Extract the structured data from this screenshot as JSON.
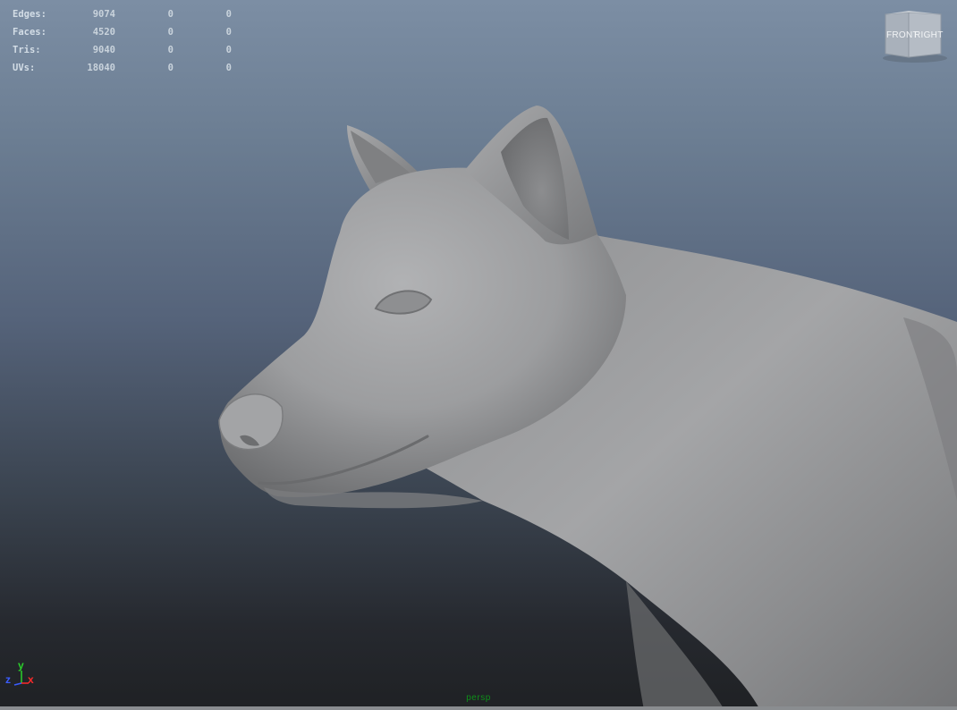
{
  "hud": {
    "rows": [
      {
        "label": "Edges:",
        "v1": "9074",
        "v2": "0",
        "v3": "0"
      },
      {
        "label": "Faces:",
        "v1": "4520",
        "v2": "0",
        "v3": "0"
      },
      {
        "label": "Tris:",
        "v1": "9040",
        "v2": "0",
        "v3": "0"
      },
      {
        "label": "UVs:",
        "v1": "18040",
        "v2": "0",
        "v3": "0"
      }
    ]
  },
  "viewcube": {
    "front_label": "FRONT",
    "right_label": "RIGHT"
  },
  "axes": {
    "y": "y",
    "x": "x",
    "z": "z",
    "colors": {
      "x": "#ff2a2a",
      "y": "#2bd12b",
      "z": "#3a5cff"
    }
  },
  "camera": {
    "name": "persp",
    "color": "#0e8f1a"
  },
  "scene": {
    "background_top": "#7c8ea4",
    "background_bottom": "#1f2124",
    "model_color": "#9a9b9d"
  }
}
